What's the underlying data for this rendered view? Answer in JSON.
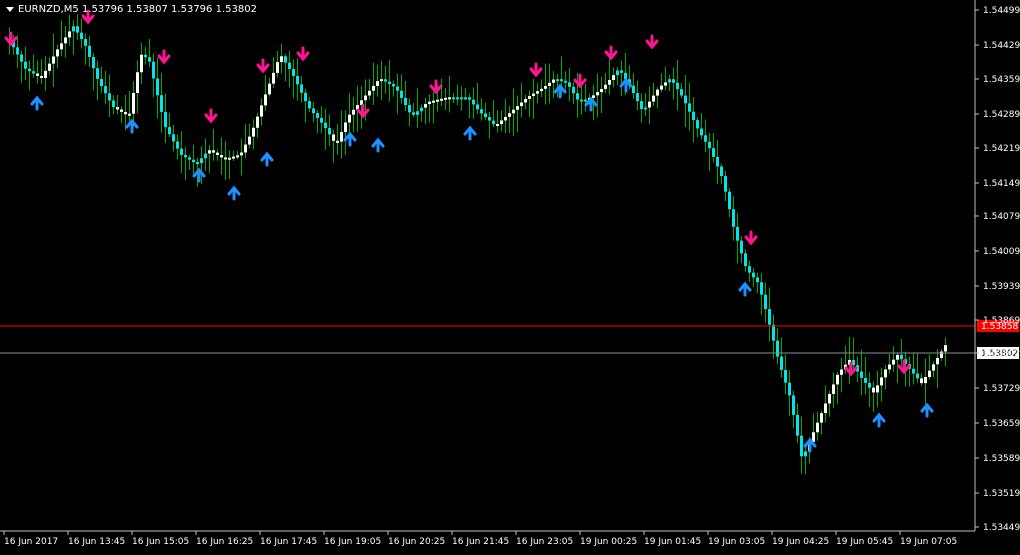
{
  "header": {
    "symbol": "EURNZD,M5",
    "ohlc": "1.53796 1.53807 1.53796 1.53802"
  },
  "colors": {
    "background": "#000000",
    "frame": "#c0c0c0",
    "wick": "#00aa00",
    "bull_body": "#ffffff",
    "bear_body": "#00e5ee",
    "buy_arrow": "#1e90ff",
    "sell_arrow": "#ff1493",
    "ask_line": "#ff0000",
    "bid_line": "#8090a0"
  },
  "icons": {
    "buy": "arrow-up-icon",
    "sell": "arrow-down-icon",
    "menu": "triangle-down-icon"
  },
  "chart_data": {
    "type": "candlestick",
    "ylim": [
      1.5341,
      1.5452
    ],
    "y_ticks": [
      "1.54499",
      "1.54429",
      "1.54359",
      "1.54289",
      "1.54219",
      "1.54149",
      "1.54079",
      "1.54009",
      "1.53939",
      "1.53869",
      "1.53802",
      "1.53729",
      "1.53659",
      "1.53589",
      "1.53519",
      "1.53449"
    ],
    "x_ticks": [
      "16 Jun 2017",
      "16 Jun 13:45",
      "16 Jun 15:05",
      "16 Jun 16:25",
      "16 Jun 17:45",
      "16 Jun 19:05",
      "16 Jun 20:25",
      "16 Jun 21:45",
      "16 Jun 23:05",
      "19 Jun 00:25",
      "19 Jun 01:45",
      "19 Jun 03:05",
      "19 Jun 04:25",
      "19 Jun 05:45",
      "19 Jun 07:05"
    ],
    "ask_price": "1.53858",
    "bid_price": "1.53802",
    "price_path": [
      [
        0,
        1.5444
      ],
      [
        8,
        1.5438
      ],
      [
        16,
        1.5436
      ],
      [
        24,
        1.5442
      ],
      [
        32,
        1.5447
      ],
      [
        38,
        1.5443
      ],
      [
        44,
        1.5436
      ],
      [
        52,
        1.543
      ],
      [
        60,
        1.5428
      ],
      [
        66,
        1.5441
      ],
      [
        70,
        1.544
      ],
      [
        78,
        1.5426
      ],
      [
        86,
        1.542
      ],
      [
        94,
        1.5418
      ],
      [
        100,
        1.5421
      ],
      [
        108,
        1.5419
      ],
      [
        116,
        1.542
      ],
      [
        122,
        1.5425
      ],
      [
        128,
        1.5432
      ],
      [
        136,
        1.5441
      ],
      [
        142,
        1.5437
      ],
      [
        150,
        1.543
      ],
      [
        158,
        1.5426
      ],
      [
        164,
        1.5422
      ],
      [
        170,
        1.5428
      ],
      [
        178,
        1.5432
      ],
      [
        186,
        1.5436
      ],
      [
        194,
        1.5434
      ],
      [
        202,
        1.5428
      ],
      [
        210,
        1.5431
      ],
      [
        220,
        1.5432
      ],
      [
        230,
        1.5432
      ],
      [
        236,
        1.5429
      ],
      [
        244,
        1.5426
      ],
      [
        252,
        1.5429
      ],
      [
        260,
        1.5432
      ],
      [
        268,
        1.5434
      ],
      [
        274,
        1.5436
      ],
      [
        280,
        1.5435
      ],
      [
        286,
        1.5431
      ],
      [
        292,
        1.5432
      ],
      [
        298,
        1.5434
      ],
      [
        306,
        1.5438
      ],
      [
        312,
        1.5434
      ],
      [
        318,
        1.5429
      ],
      [
        326,
        1.5434
      ],
      [
        332,
        1.5436
      ],
      [
        338,
        1.5432
      ],
      [
        346,
        1.5425
      ],
      [
        352,
        1.5421
      ],
      [
        358,
        1.5415
      ],
      [
        364,
        1.5404
      ],
      [
        370,
        1.5396
      ],
      [
        376,
        1.5393
      ],
      [
        380,
        1.5387
      ],
      [
        386,
        1.5377
      ],
      [
        392,
        1.5369
      ],
      [
        398,
        1.5356
      ],
      [
        404,
        1.5362
      ],
      [
        410,
        1.5368
      ],
      [
        416,
        1.5374
      ],
      [
        422,
        1.5377
      ],
      [
        428,
        1.5373
      ],
      [
        434,
        1.537
      ],
      [
        440,
        1.5375
      ],
      [
        446,
        1.5378
      ],
      [
        452,
        1.5375
      ],
      [
        458,
        1.5372
      ],
      [
        464,
        1.5376
      ],
      [
        470,
        1.538
      ]
    ],
    "first_candle_time_index": 0,
    "total_candles": 470,
    "sell_signals": [
      5,
      46,
      114,
      148,
      190,
      242,
      296,
      318,
      342,
      382,
      448,
      474,
      580
    ],
    "buy_signals": [
      18,
      64,
      124,
      164,
      242,
      270,
      326,
      378,
      434,
      458,
      496,
      560,
      598,
      700,
      718
    ],
    "notes": "sell/buy signals are bar indices along price_path scale where arrows appear"
  }
}
